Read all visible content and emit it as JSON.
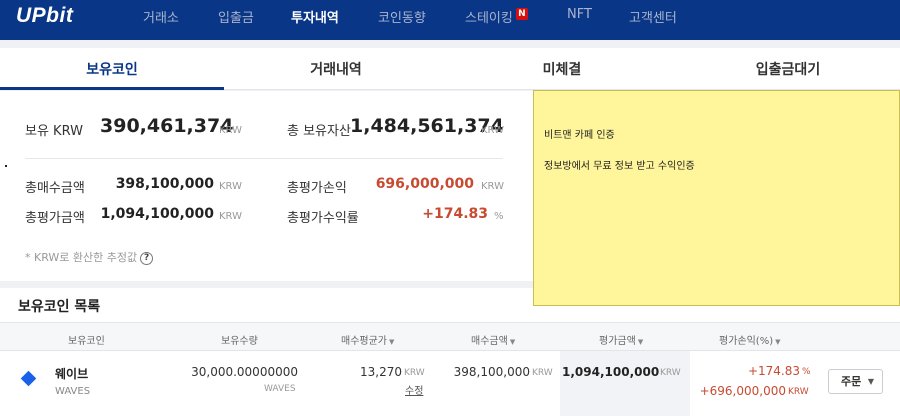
{
  "nav": {
    "logo": "UPbit",
    "items": [
      "거래소",
      "입출금",
      "투자내역",
      "코인동향",
      "스테이킹",
      "NFT",
      "고객센터"
    ],
    "new_badge": "N",
    "active": "투자내역"
  },
  "tabs": [
    "보유코인",
    "거래내역",
    "미체결",
    "입출금대기"
  ],
  "summary": {
    "krw_label": "보유 KRW",
    "krw_value": "390,461,374",
    "total_assets_label": "총 보유자산",
    "total_assets_value": "1,484,561,374",
    "unit": "KRW",
    "buy_total_label": "총매수금액",
    "buy_total_value": "398,100,000",
    "pnl_label": "총평가손익",
    "pnl_value": "696,000,000",
    "eval_total_label": "총평가금액",
    "eval_total_value": "1,094,100,000",
    "return_label": "총평가수익률",
    "return_value": "+174.83",
    "percent": "%",
    "note": "* KRW로 환산한 추정값",
    "help": "?"
  },
  "sticky_note": {
    "line1": "비트맨 카페 인증",
    "line2": "정보방에서 무료 정보 받고 수익인증"
  },
  "coin_list": {
    "title": "보유코인 목록",
    "headers": [
      "보유코인",
      "보유수량",
      "매수평균가",
      "매수금액",
      "평가금액",
      "평가손익(%)"
    ],
    "rows": [
      {
        "name": "웨이브",
        "symbol": "WAVES",
        "quantity": "30,000.00000000",
        "quantity_unit": "WAVES",
        "avg_price": "13,270",
        "avg_unit": "KRW",
        "edit": "수정",
        "buy_amount": "398,100,000",
        "buy_unit": "KRW",
        "eval_amount": "1,094,100,000",
        "eval_unit": "KRW",
        "return_pct": "+174.83",
        "pct_unit": "%",
        "return_amount": "+696,000,000",
        "return_unit": "KRW",
        "order": "주문"
      }
    ]
  },
  "colors": {
    "nav_bg": "#093687",
    "red": "#c84a31",
    "sticky": "#fff59a",
    "coin_icon": "#1961e8"
  }
}
